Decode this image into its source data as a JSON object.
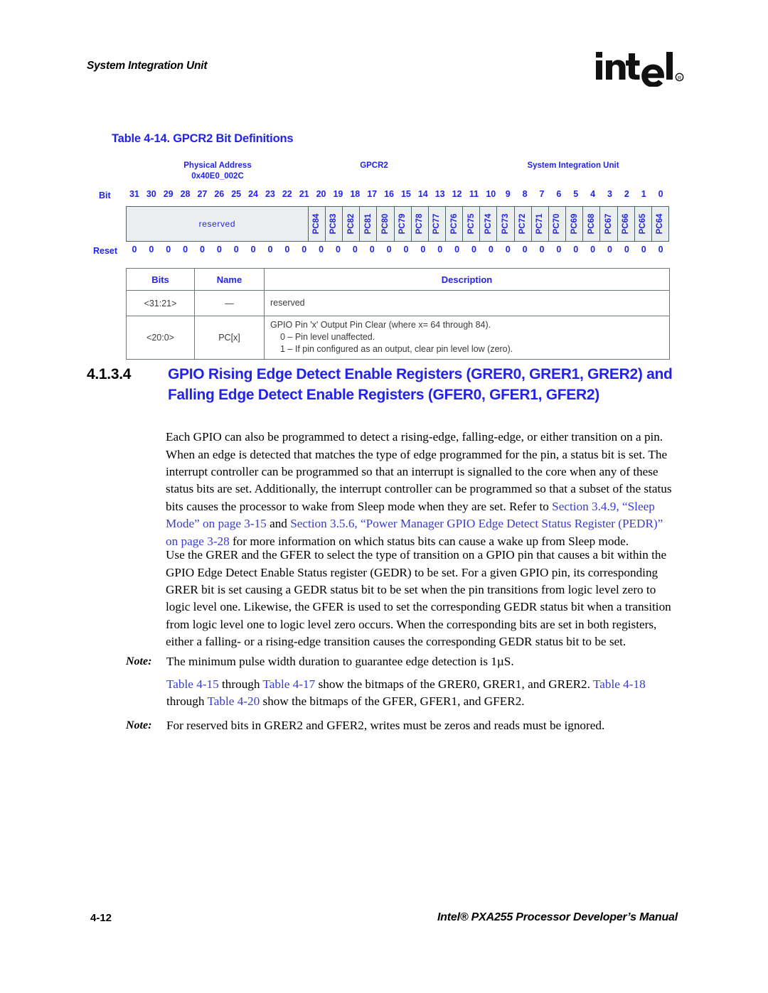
{
  "running_header": "System Integration Unit",
  "logo": {
    "name": "intel-logo",
    "text": "intel",
    "registered_mark": "®"
  },
  "table_caption": "Table 4-14. GPCR2 Bit Definitions",
  "register_diagram": {
    "physical_address_label": "Physical Address",
    "physical_address_value": "0x40E0_002C",
    "register_name": "GPCR2",
    "unit_name": "System Integration Unit",
    "bit_row_label": "Bit",
    "reset_row_label": "Reset",
    "bit_numbers": [
      "31",
      "30",
      "29",
      "28",
      "27",
      "26",
      "25",
      "24",
      "23",
      "22",
      "21",
      "20",
      "19",
      "18",
      "17",
      "16",
      "15",
      "14",
      "13",
      "12",
      "11",
      "10",
      "9",
      "8",
      "7",
      "6",
      "5",
      "4",
      "3",
      "2",
      "1",
      "0"
    ],
    "reserved_label": "reserved",
    "reserved_span_bits": 11,
    "field_labels": [
      "PC84",
      "PC83",
      "PC82",
      "PC81",
      "PC80",
      "PC79",
      "PC78",
      "PC77",
      "PC76",
      "PC75",
      "PC74",
      "PC73",
      "PC72",
      "PC71",
      "PC70",
      "PC69",
      "PC68",
      "PC67",
      "PC66",
      "PC65",
      "PC64"
    ],
    "reset_values": [
      "0",
      "0",
      "0",
      "0",
      "0",
      "0",
      "0",
      "0",
      "0",
      "0",
      "0",
      "0",
      "0",
      "0",
      "0",
      "0",
      "0",
      "0",
      "0",
      "0",
      "0",
      "0",
      "0",
      "0",
      "0",
      "0",
      "0",
      "0",
      "0",
      "0",
      "0",
      "0"
    ]
  },
  "bits_table": {
    "headers": [
      "Bits",
      "Name",
      "Description"
    ],
    "rows": [
      {
        "bits": "<31:21>",
        "name": "—",
        "desc_main": "reserved",
        "desc_lines": []
      },
      {
        "bits": "<20:0>",
        "name": "PC[x]",
        "desc_main": "GPIO Pin 'x' Output Pin Clear (where x= 64 through 84).",
        "desc_lines": [
          "0 – Pin level unaffected.",
          "1 – If pin configured as an output, clear pin level low (zero)."
        ]
      }
    ]
  },
  "section": {
    "number": "4.1.3.4",
    "title_line1": "GPIO Rising Edge Detect Enable Registers (GRER0, GRER1, GRER2)",
    "title_line2": "and Falling Edge Detect Enable Registers (GFER0, GFER1, GFER2)"
  },
  "paragraphs": {
    "p1_a": "Each GPIO can also be programmed to detect a rising-edge, falling-edge, or either transition on a pin. When an edge is detected that matches the type of edge programmed for the pin, a status bit is set. The interrupt controller can be programmed so that an interrupt is signalled to the core when any of these status bits are set. Additionally, the interrupt controller can be programmed so that a subset of the status bits causes the processor to wake from Sleep mode when they are set. Refer to ",
    "p1_link1": "Section 3.4.9, “Sleep Mode” on page 3-15",
    "p1_b": " and ",
    "p1_link2": "Section 3.5.6, “Power Manager GPIO Edge Detect Status Register (PEDR)” on page 3-28",
    "p1_c": " for more information on which status bits can cause a wake up from Sleep mode.",
    "p2": "Use the GRER and the GFER to select the type of transition on a GPIO pin that causes a bit within the GPIO Edge Detect Enable Status register (GEDR) to be set. For a given GPIO pin, its corresponding GRER bit is set causing a GEDR status bit to be set when the pin transitions from logic level zero to logic level one. Likewise, the GFER is used to set the corresponding GEDR status bit when a transition from logic level one to logic level zero occurs. When the corresponding bits are set in both registers, either a falling- or a rising-edge transition causes the corresponding GEDR status bit to be set."
  },
  "notes": {
    "label": "Note:",
    "note1": "The minimum pulse width duration to guarantee edge detection is 1µS.",
    "note2_link1": "Table 4-15",
    "note2_a": " through ",
    "note2_link2": "Table 4-17",
    "note2_b": " show the bitmaps of the GRER0, GRER1, and GRER2. ",
    "note2_link3": "Table 4-18",
    "note2_c": " through ",
    "note2_link4": "Table 4-20",
    "note2_d": " show the bitmaps of the GFER, GFER1, and GFER2.",
    "note3": "For reserved bits in GRER2 and GFER2, writes must be zeros and reads must be ignored."
  },
  "footer": {
    "page_number": "4-12",
    "document_title": "Intel® PXA255 Processor Developer’s Manual"
  },
  "colors": {
    "link_blue": "#3a3ad0",
    "heading_blue": "#2323e8",
    "field_border": "#4b6465",
    "field_fill": "#eaeeee"
  }
}
